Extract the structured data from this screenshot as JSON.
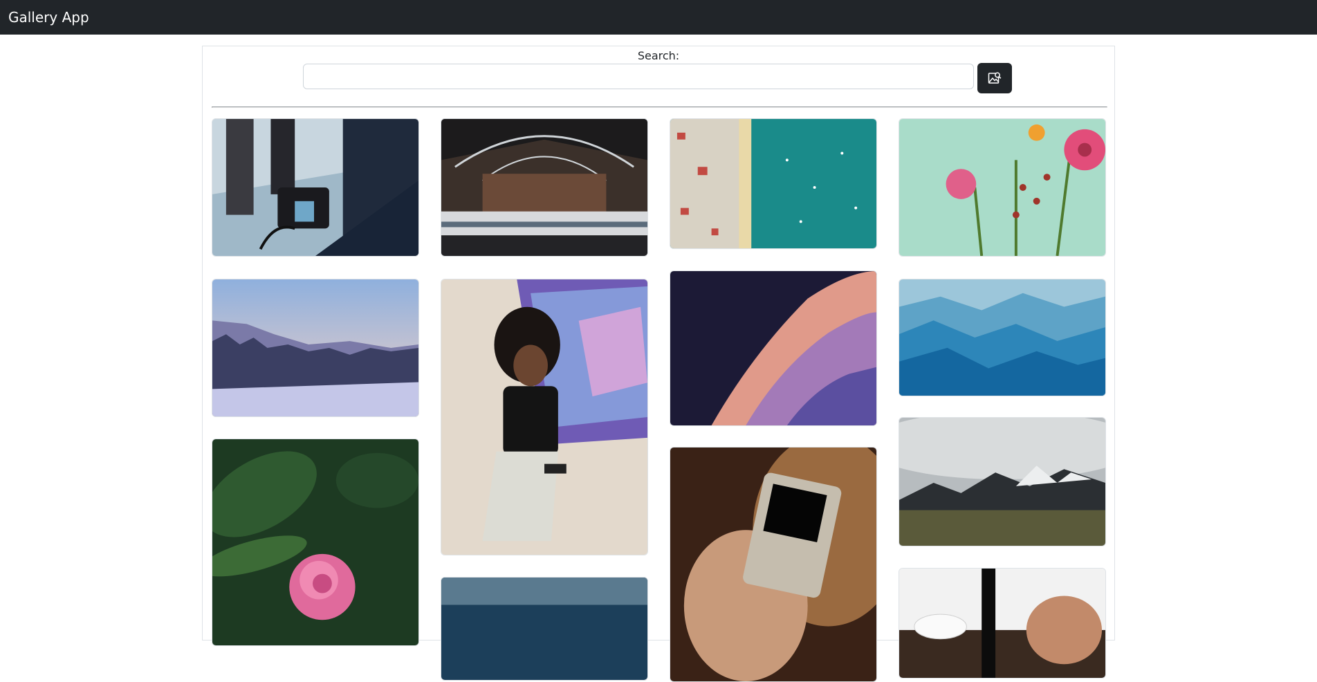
{
  "navbar": {
    "brand": "Gallery App"
  },
  "search": {
    "label": "Search:",
    "value": "",
    "placeholder": ""
  },
  "search_button": {
    "icon": "image-search-icon"
  },
  "gallery": {
    "columns": [
      [
        "Camera monitor on set",
        "Snowy forest at dusk",
        "Pink peony flower"
      ],
      [
        "Railway station interior",
        "Woman holding device by TV",
        "Ocean aerial"
      ],
      [
        "Aerial coastline with boats",
        "Slot canyon sandstone",
        "Handheld retro console"
      ],
      [
        "Pink gerbera flowers",
        "Blue misty mountains",
        "Cloudy mountain range",
        "Desk with game controller"
      ]
    ]
  }
}
